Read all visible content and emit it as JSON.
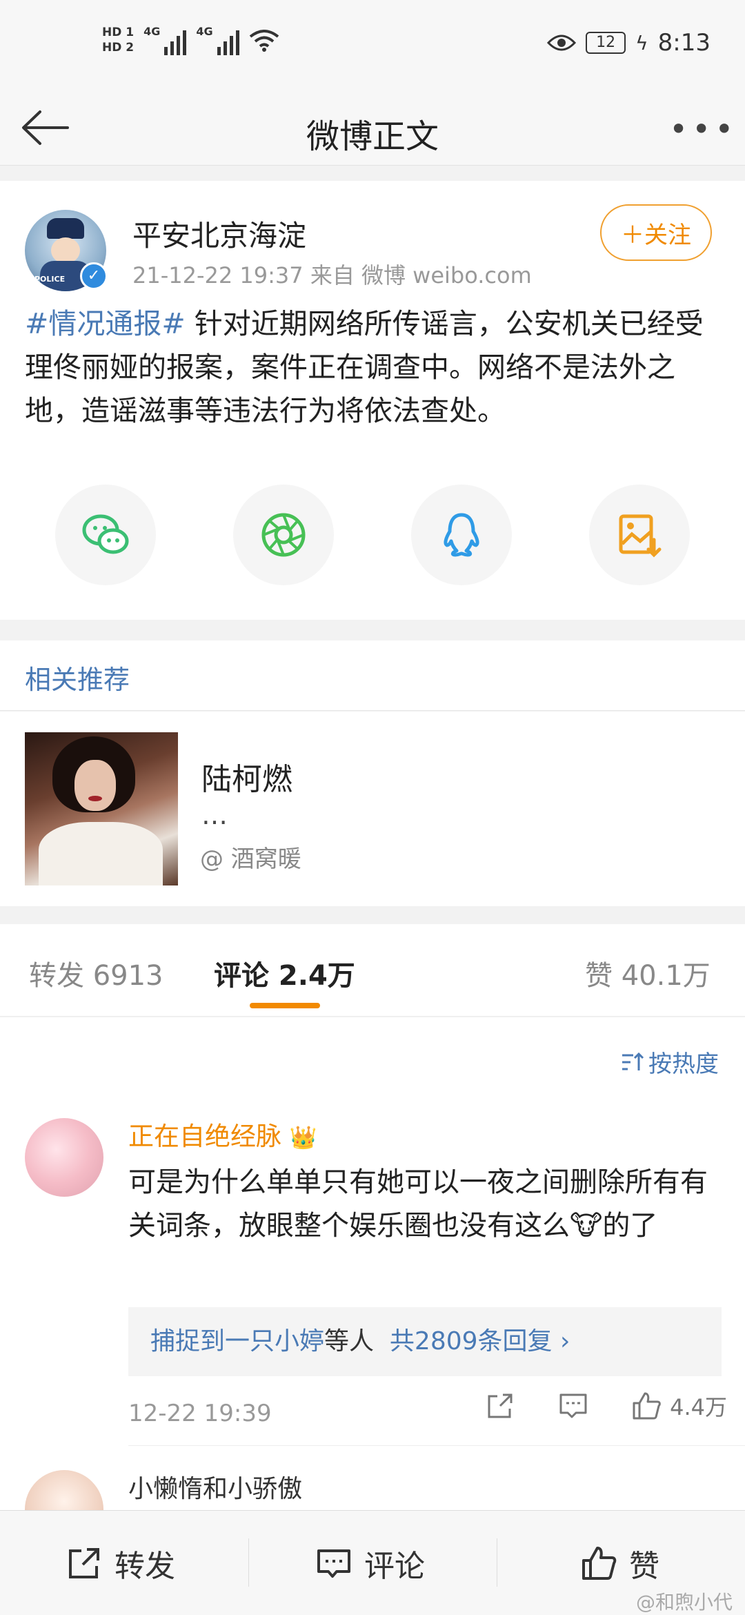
{
  "status_bar": {
    "sim1": "HD 1",
    "sim2": "HD 2",
    "net1": "4G",
    "net2": "4G",
    "battery": "12",
    "time": "8:13"
  },
  "header": {
    "title": "微博正文",
    "more": "•••"
  },
  "post": {
    "author": "平安北京海淀",
    "avatar_label": "POLICE",
    "meta": "21-12-22 19:37   来自 微博 weibo.com",
    "follow_label": "＋关注",
    "hashtag": "#情况通报#",
    "text": " 针对近期网络所传谣言，公安机关已经受理佟丽娅的报案，案件正在调查中。网络不是法外之地，造谣滋事等违法行为将依法查处。",
    "share_icons": [
      "wechat-icon",
      "moments-icon",
      "qq-icon",
      "save-image-icon"
    ],
    "colors": {
      "wechat": "#3bbf73",
      "moments": "#47c055",
      "qq": "#2f9be6",
      "save": "#f0a020"
    }
  },
  "related": {
    "title": "相关推荐",
    "item": {
      "title": "陆柯燃",
      "desc": "…",
      "source": "@ 酒窝暖"
    }
  },
  "tabs": {
    "repost": "转发 6913",
    "comment": "评论 2.4万",
    "like": "赞 40.1万"
  },
  "comments": {
    "sort_label": "按热度",
    "first": {
      "name": "正在自绝经脉",
      "crown": "👑",
      "text_before": "可是为什么单单只有她可以一夜之间删除所有有关词条，放眼整个娱乐圈也没有这么",
      "emoji": "🐮",
      "text_after": "的了",
      "reply_user": "捕捉到一只小婷",
      "reply_mid": "等人",
      "reply_count": "共2809条回复 ›",
      "time": "12-22 19:39",
      "likes": "4.4万"
    },
    "second": {
      "name": "小懒惰和小骄傲"
    }
  },
  "bottom_bar": {
    "repost": "转发",
    "comment": "评论",
    "like": "赞"
  },
  "watermark": "@和煦小代",
  "accent_color": "#f28a00",
  "link_color": "#4a7ab5"
}
